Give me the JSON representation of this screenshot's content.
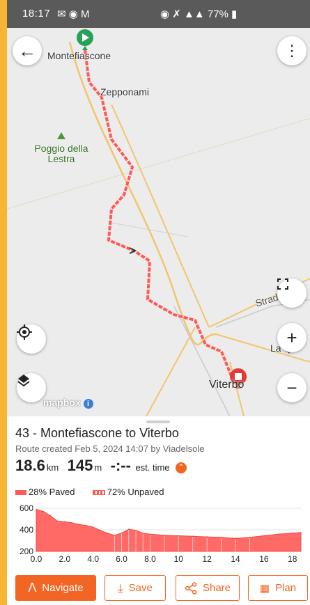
{
  "status_bar": {
    "time": "18:17",
    "battery": "77%"
  },
  "map": {
    "places": {
      "start": "Montefiascone",
      "zepponami": "Zepponami",
      "poggio": "Poggio della Lestra",
      "strade": "Strade",
      "la_quercia": "La Qu",
      "end": "Viterbo"
    },
    "attribution": "mapbox",
    "icons": [
      "back-arrow-icon",
      "more-vert-icon",
      "fullscreen-icon",
      "zoom-in-icon",
      "zoom-out-icon",
      "locate-icon",
      "layers-icon",
      "info-icon"
    ]
  },
  "route": {
    "title": "43 - Montefiascone to Viterbo",
    "subtitle": "Route created Feb 5, 2024 14:07 by Viadelsole",
    "distance": "18.6",
    "distance_unit": "km",
    "elevation": "145",
    "elevation_unit": "m",
    "time": "-:--",
    "time_label": "est. time"
  },
  "surface": {
    "paved": "28% Paved",
    "unpaved": "72% Unpaved"
  },
  "colors": {
    "accent": "#f26522",
    "route": "#ff5a55"
  },
  "chart_data": {
    "type": "area",
    "x": [
      0,
      0.5,
      1,
      1.5,
      2,
      2.5,
      3,
      3.5,
      4,
      4.5,
      5,
      5.5,
      6,
      6.5,
      7,
      7.5,
      8,
      9,
      10,
      11,
      12,
      13,
      14,
      15,
      16,
      17,
      18,
      18.6
    ],
    "y": [
      590,
      570,
      530,
      480,
      475,
      465,
      450,
      440,
      425,
      395,
      370,
      350,
      370,
      405,
      395,
      370,
      360,
      350,
      345,
      340,
      335,
      330,
      320,
      330,
      345,
      360,
      370,
      375
    ],
    "xticks": [
      "0.0",
      "2.0",
      "4.0",
      "6.0",
      "8.0",
      "10",
      "12",
      "14",
      "16",
      "18"
    ],
    "yticks": [
      "600",
      "400",
      "200"
    ],
    "xlim": [
      0,
      18.6
    ],
    "ylim": [
      200,
      600
    ]
  },
  "actions": {
    "navigate": "Navigate",
    "save": "Save",
    "share": "Share",
    "plan": "Plan"
  }
}
